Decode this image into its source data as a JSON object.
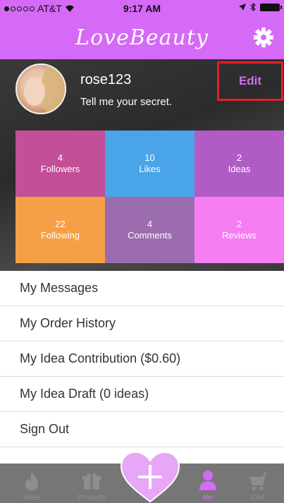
{
  "status_bar": {
    "carrier": "AT&T",
    "time": "9:17 AM"
  },
  "header": {
    "app_title": "LoveBeauty"
  },
  "profile": {
    "username": "rose123",
    "tagline": "Tell me your secret.",
    "edit_label": "Edit"
  },
  "stats": [
    {
      "value": "4",
      "label": "Followers",
      "color": "#c24f98"
    },
    {
      "value": "10",
      "label": "Likes",
      "color": "#4aa4e8"
    },
    {
      "value": "2",
      "label": "Ideas",
      "color": "#b15cc4"
    },
    {
      "value": "22",
      "label": "Following",
      "color": "#f5a046"
    },
    {
      "value": "4",
      "label": "Comments",
      "color": "#9b6dae"
    },
    {
      "value": "2",
      "label": "Reviews",
      "color": "#f47ef2"
    }
  ],
  "menu": [
    {
      "label": "My Messages"
    },
    {
      "label": "My Order History"
    },
    {
      "label": "My Idea Contribution ($0.60)"
    },
    {
      "label": "My Idea Draft (0 ideas)"
    },
    {
      "label": "Sign Out"
    }
  ],
  "tab_bar": {
    "tabs": [
      {
        "label": "Ideas",
        "icon": "flame-icon"
      },
      {
        "label": "Products",
        "icon": "gift-icon"
      },
      {
        "label": "",
        "icon": "plus-heart-icon"
      },
      {
        "label": "Me",
        "icon": "person-icon"
      },
      {
        "label": "Cart",
        "icon": "cart-icon"
      }
    ]
  },
  "colors": {
    "brand": "#d56af7",
    "edit_highlight": "#e0212a",
    "tabbar_bg": "#767676"
  }
}
